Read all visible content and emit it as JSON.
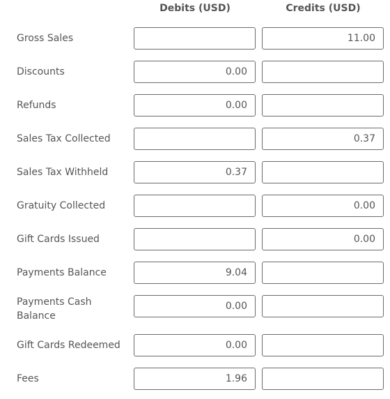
{
  "headers": {
    "debits": "Debits (USD)",
    "credits": "Credits (USD)"
  },
  "rows": [
    {
      "label": "Gross Sales",
      "debit": "",
      "credit": "11.00"
    },
    {
      "label": "Discounts",
      "debit": "0.00",
      "credit": ""
    },
    {
      "label": "Refunds",
      "debit": "0.00",
      "credit": ""
    },
    {
      "label": "Sales Tax Collected",
      "debit": "",
      "credit": "0.37"
    },
    {
      "label": "Sales Tax Withheld",
      "debit": "0.37",
      "credit": ""
    },
    {
      "label": "Gratuity Collected",
      "debit": "",
      "credit": "0.00"
    },
    {
      "label": "Gift Cards Issued",
      "debit": "",
      "credit": "0.00"
    },
    {
      "label": "Payments Balance",
      "debit": "9.04",
      "credit": ""
    },
    {
      "label": "Payments Cash Balance",
      "debit": "0.00",
      "credit": ""
    },
    {
      "label": "Gift Cards Redeemed",
      "debit": "0.00",
      "credit": ""
    },
    {
      "label": "Fees",
      "debit": "1.96",
      "credit": ""
    }
  ]
}
